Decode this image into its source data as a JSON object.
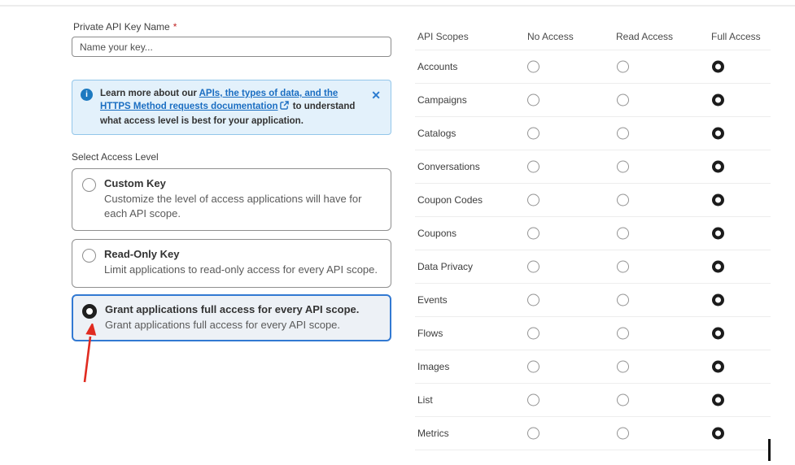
{
  "form": {
    "name_label": "Private API Key Name",
    "required_marker": "*",
    "name_placeholder": "Name your key...",
    "name_value": "",
    "banner": {
      "info_glyph": "i",
      "prefix": "Learn more about our ",
      "link_text": "APIs, the types of data, and the HTTPS Method requests documentation",
      "suffix": " to understand what access level is best for your application.",
      "close_glyph": "✕"
    },
    "access_level_label": "Select Access Level",
    "options": [
      {
        "title": "Custom Key",
        "description": "Customize the level of access applications will have for each API scope.",
        "selected": false
      },
      {
        "title": "Read-Only Key",
        "description": "Limit applications to read-only access for every API scope.",
        "selected": false
      },
      {
        "title": "Grant applications full access for every API scope.",
        "description": "Grant applications full access for every API scope.",
        "selected": true
      }
    ]
  },
  "scopes_table": {
    "headers": [
      "API Scopes",
      "No Access",
      "Read Access",
      "Full Access"
    ],
    "rows": [
      {
        "name": "Accounts",
        "access": "full"
      },
      {
        "name": "Campaigns",
        "access": "full"
      },
      {
        "name": "Catalogs",
        "access": "full"
      },
      {
        "name": "Conversations",
        "access": "full"
      },
      {
        "name": "Coupon Codes",
        "access": "full"
      },
      {
        "name": "Coupons",
        "access": "full"
      },
      {
        "name": "Data Privacy",
        "access": "full"
      },
      {
        "name": "Events",
        "access": "full"
      },
      {
        "name": "Flows",
        "access": "full"
      },
      {
        "name": "Images",
        "access": "full"
      },
      {
        "name": "List",
        "access": "full"
      },
      {
        "name": "Metrics",
        "access": "full"
      }
    ]
  },
  "colors": {
    "accent_blue": "#1b6ec2",
    "banner_bg": "#e3f1fb",
    "banner_border": "#93c6ea",
    "selected_card_border": "#3279d2",
    "selected_card_bg": "#edf1f6",
    "radio_selected": "#1c1c1c",
    "arrow_red": "#e02b20",
    "required_red": "#c02424"
  }
}
